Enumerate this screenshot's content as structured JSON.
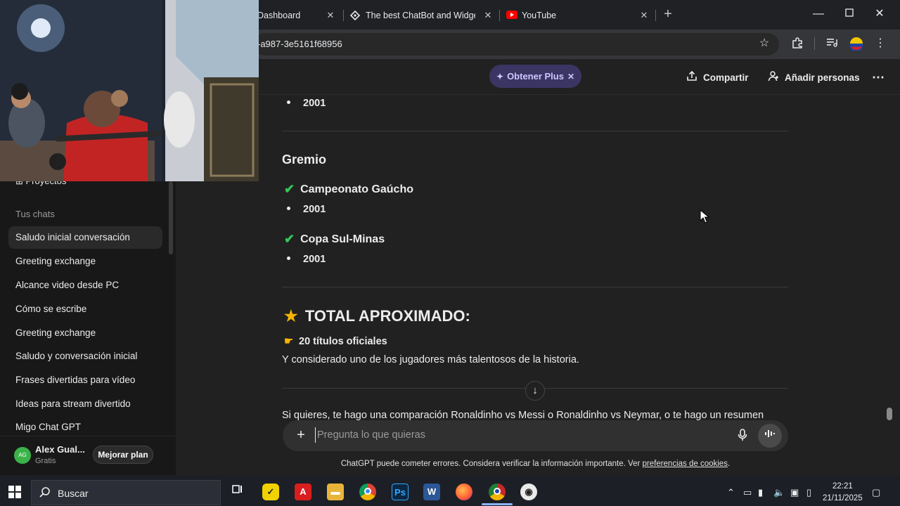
{
  "browser": {
    "tabs": [
      {
        "title": "Dashboard"
      },
      {
        "title": "The best ChatBot and Widgets"
      },
      {
        "title": "YouTube"
      }
    ],
    "url": "-a987-3e5161f68956"
  },
  "header": {
    "plus_label": "Obtener Plus",
    "share_label": "Compartir",
    "add_people_label": "Añadir personas"
  },
  "sidebar": {
    "projects_label": "Proyectos",
    "chats_heading": "Tus chats",
    "chats": [
      {
        "label": "Saludo inicial conversación"
      },
      {
        "label": "Greeting exchange"
      },
      {
        "label": "Alcance video desde PC"
      },
      {
        "label": "Cómo se escribe"
      },
      {
        "label": "Greeting exchange"
      },
      {
        "label": "Saludo y conversación inicial"
      },
      {
        "label": "Frases divertidas para vídeo"
      },
      {
        "label": "Ideas para stream divertido"
      },
      {
        "label": "Migo Chat GPT"
      }
    ],
    "user": {
      "initials": "AG",
      "name": "Alex Gual...",
      "plan": "Gratis",
      "upgrade_label": "Mejorar plan"
    }
  },
  "content": {
    "top_bullet": "2001",
    "section_title": "Gremio",
    "titles": [
      {
        "name": "Campeonato Gaúcho",
        "year": "2001"
      },
      {
        "name": "Copa Sul-Minas",
        "year": "2001"
      }
    ],
    "total_title": "TOTAL APROXIMADO:",
    "total_count": "20 títulos oficiales",
    "summary": "Y considerado uno de los jugadores más talentosos de la historia.",
    "cut_off_text": "Si quieres, te hago una comparación Ronaldinho vs Messi o Ronaldinho vs Neymar, o te hago un resumen"
  },
  "composer": {
    "placeholder": "Pregunta lo que quieras"
  },
  "disclaimer": {
    "text": "ChatGPT puede cometer errores. Considera verificar la información importante. Ver",
    "link": "preferencias de cookies",
    "end": "."
  },
  "taskbar": {
    "search_label": "Buscar",
    "time": "22:21",
    "date": "21/11/2025"
  },
  "colors": {
    "accent_check": "#35c759",
    "plus_pill": "#3b3564",
    "star": "#f4b400"
  }
}
